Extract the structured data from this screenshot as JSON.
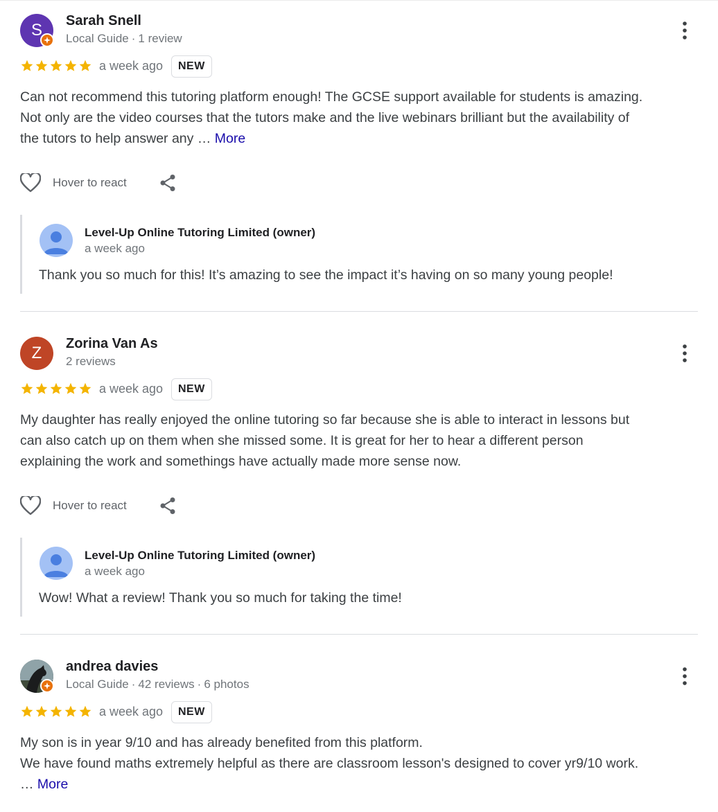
{
  "colors": {
    "star": "#f4b400",
    "link": "#1a0dab",
    "guide_badge": "#e8710a",
    "owner_avatar": "#a3c1f5"
  },
  "reviews": [
    {
      "name": "Sarah Snell",
      "avatar_letter": "S",
      "avatar_color": "#5e35b1",
      "local_guide": true,
      "meta": [
        "Local Guide",
        "1 review"
      ],
      "rating": 5,
      "date": "a week ago",
      "badge": "NEW",
      "text_lines": [
        "Can not recommend this tutoring platform enough! The GCSE support available for students is amazing.",
        "Not only are the video courses that the tutors make and the live webinars brilliant but the availability of",
        "the tutors to help answer any … "
      ],
      "more_label": "More",
      "react_label": "Hover to react",
      "owner_reply": {
        "name": "Level-Up Online Tutoring Limited (owner)",
        "date": "a week ago",
        "text": "Thank you so much for this! It’s amazing to see the impact it’s having on so many young people!"
      }
    },
    {
      "name": "Zorina Van As",
      "avatar_letter": "Z",
      "avatar_color": "#bf4526",
      "local_guide": false,
      "meta": [
        "2 reviews"
      ],
      "rating": 5,
      "date": "a week ago",
      "badge": "NEW",
      "text_lines": [
        "My daughter has really enjoyed the online tutoring so far because she is able to interact in lessons but",
        "can also catch up on them when she missed some. It is great for her to hear a different person",
        "explaining the work and somethings have actually made more sense now."
      ],
      "react_label": "Hover to react",
      "owner_reply": {
        "name": "Level-Up Online Tutoring Limited (owner)",
        "date": "a week ago",
        "text": "Wow! What a review! Thank you so much for taking the time!"
      }
    },
    {
      "name": "andrea davies",
      "avatar_letter": "",
      "local_guide": true,
      "meta": [
        "Local Guide",
        "42 reviews",
        "6 photos"
      ],
      "rating": 5,
      "date": "a week ago",
      "badge": "NEW",
      "text_lines": [
        "My son is in year 9/10 and has already benefited from this platform.",
        "We have found maths extremely helpful as there are classroom lesson's designed to cover yr9/10 work.",
        "… "
      ],
      "more_label": "More"
    }
  ],
  "icons": {
    "menu": "more-vert-icon",
    "heart": "heart-outline-icon",
    "share": "share-icon",
    "star": "star-icon",
    "guide": "local-guide-badge-icon"
  }
}
